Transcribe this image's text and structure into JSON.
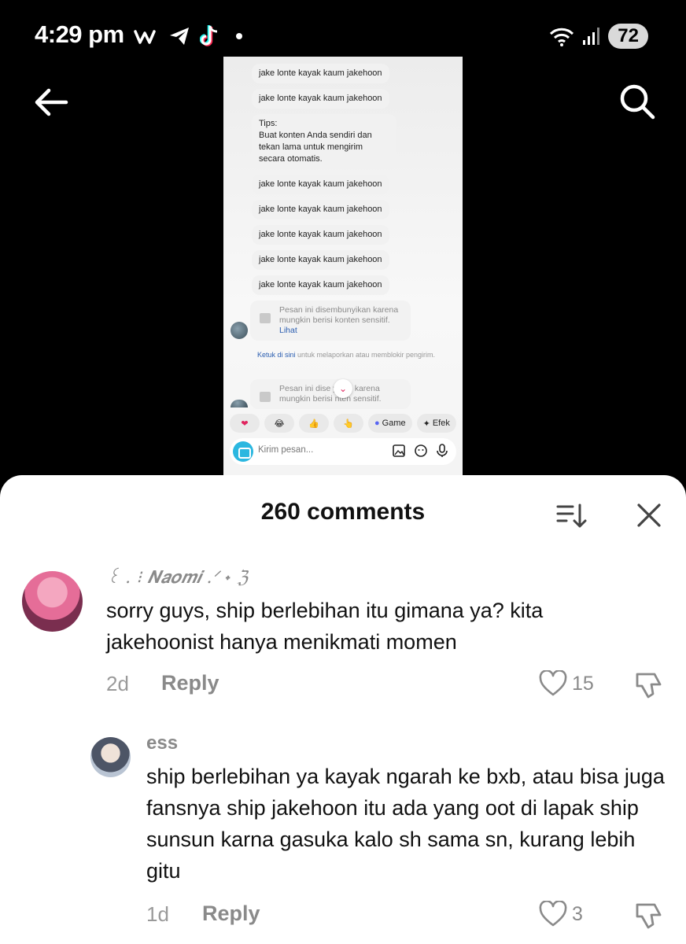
{
  "status_bar": {
    "time": "4:29 pm",
    "battery": "72",
    "app_icons": [
      "w-app-icon",
      "telegram-icon",
      "tiktok-icon"
    ]
  },
  "embedded_screenshot": {
    "messages": [
      "jake lonte kayak kaum jakehoon",
      "jake lonte kayak kaum jakehoon",
      "Tips:\nBuat konten Anda sendiri dan\ntekan lama untuk mengirim\nsecara otomatis.",
      "jake lonte kayak kaum jakehoon",
      "jake lonte kayak kaum jakehoon",
      "jake lonte kayak kaum jakehoon",
      "jake lonte kayak kaum jakehoon",
      "jake lonte kayak kaum jakehoon"
    ],
    "hidden_message_1": "Pesan ini disembunyikan karena mungkin berisi konten sensitif.",
    "hidden_message_link": "Lihat",
    "report_link": "Ketuk di sini",
    "report_text": " untuk melaporkan atau memblokir pengirim.",
    "hidden_message_2": "Pesan ini dise    yikan karena mungkin berisi    nten sensitif.",
    "quick_chips": [
      "❤",
      "😂",
      "👍",
      "👆",
      "Game",
      "Efek"
    ],
    "compose_placeholder": "Kirim pesan..."
  },
  "sheet": {
    "title": "260 comments"
  },
  "comments": [
    {
      "username": "꒰ . ⁝ 𝑵𝒂𝒐𝒎𝒊 .ᐟ ˖ ℨ",
      "text": "sorry guys, ship berlebihan itu gimana ya? kita jakehoonist hanya menikmati momen",
      "age": "2d",
      "reply_label": "Reply",
      "likes": "15"
    },
    {
      "username": "ess",
      "text": "ship berlebihan ya kayak ngarah ke bxb, atau bisa juga fansnya ship jakehoon itu ada yang oot di lapak ship sunsun karna gasuka kalo sh sama sn, kurang lebih gitu",
      "age": "1d",
      "reply_label": "Reply",
      "likes": "3"
    }
  ]
}
